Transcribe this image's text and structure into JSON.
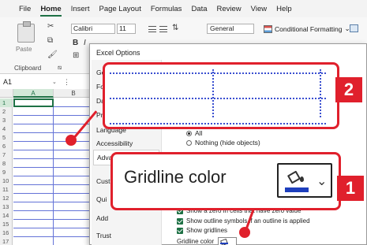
{
  "menu": {
    "tabs": [
      "File",
      "Home",
      "Insert",
      "Page Layout",
      "Formulas",
      "Data",
      "Review",
      "View",
      "Help"
    ],
    "active_tab": "Home"
  },
  "ribbon": {
    "paste_label": "Paste",
    "clipboard_label": "Clipboard",
    "font_name": "Calibri",
    "font_size": "11",
    "number_format": "General",
    "conditional_formatting": "Conditional Formatting"
  },
  "formula_bar": {
    "name_box": "A1"
  },
  "grid": {
    "columns": [
      "A",
      "B"
    ],
    "rows": [
      "1",
      "2",
      "3",
      "4",
      "5",
      "6",
      "7",
      "8",
      "9",
      "10",
      "11",
      "12",
      "13",
      "14",
      "15",
      "16",
      "17"
    ],
    "gridline_color": "#4a5bd1"
  },
  "dialog": {
    "title": "Excel Options",
    "nav_items": [
      "Gen",
      "Fo",
      "Da",
      "Pr",
      "Language",
      "Accessibility",
      "Advanced",
      "Cust",
      "Qui",
      "Add",
      "Trust"
    ],
    "selected_nav": "Advanced",
    "radio_all": "All",
    "radio_nothing": "Nothing (hide objects)",
    "chk_zero": "Show a zero in cells that have zero value",
    "chk_outline": "Show outline symbols if an outline is applied",
    "chk_gridlines": "Show gridlines",
    "gridline_color_label": "Gridline color"
  },
  "callouts": {
    "zoom_label": "Gridline color",
    "zoom_badge": "1",
    "preview_badge": "2",
    "accent_color": "#e0202c",
    "picker_color": "#1e3fbd"
  }
}
